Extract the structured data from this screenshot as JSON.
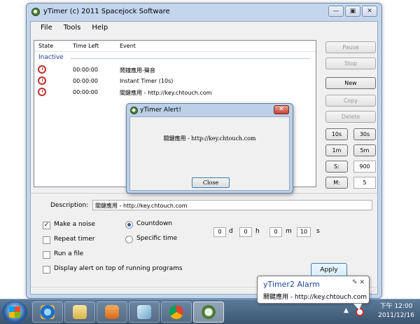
{
  "window": {
    "title": "yTimer (c) 2011 Spacejock Software",
    "controls": [
      "—",
      "▣",
      "✕"
    ]
  },
  "menu": [
    "File",
    "Tools",
    "Help"
  ],
  "list": {
    "columns": [
      "State",
      "Time Left",
      "Event"
    ],
    "group": "Inactive",
    "rows": [
      {
        "time": "00:00:00",
        "event": "鬧鐘應用-聲音"
      },
      {
        "time": "00:00:00",
        "event": "Instant Timer (10s)"
      },
      {
        "time": "00:00:00",
        "event": "關鍵應用 - http://key.chtouch.com"
      }
    ]
  },
  "side_buttons": {
    "pause": "Pause",
    "stop": "Stop",
    "new": "New",
    "copy": "Copy",
    "delete": "Delete"
  },
  "quick": {
    "b10s": "10s",
    "b30s": "30s",
    "b1m": "1m",
    "b5m": "5m",
    "s_label": "S:",
    "s_value": "900",
    "m_label": "M:",
    "m_value": "5"
  },
  "form": {
    "description_label": "Description:",
    "description_value": "關鍵應用 - http://key.chtouch.com",
    "make_noise": "Make a noise",
    "repeat_timer": "Repeat timer",
    "run_file": "Run a file",
    "display_alert": "Display alert on top of running programs",
    "countdown": "Countdown",
    "specific_time": "Specific time",
    "days": "0",
    "d": "d",
    "hours": "0",
    "h": "h",
    "minutes": "0",
    "m": "m",
    "seconds": "10",
    "s": "s",
    "apply": "Apply",
    "check_mark": "✓"
  },
  "alert": {
    "title": "yTimer Alert!",
    "message": "關鍵應用 - http://key.chtouch.com",
    "close_button": "Close",
    "close_x": "✕"
  },
  "balloon": {
    "title": "yTimer2 Alarm",
    "text": "關鍵應用 - http://key.chtouch.com",
    "tools": "✎ ✕"
  },
  "taskbar": {
    "time": "下午 12:00",
    "date": "2011/12/16"
  },
  "colors": {
    "window_frame": "#c3d6ec",
    "group_text": "#1e3aa0",
    "close_red": "#c24330"
  }
}
